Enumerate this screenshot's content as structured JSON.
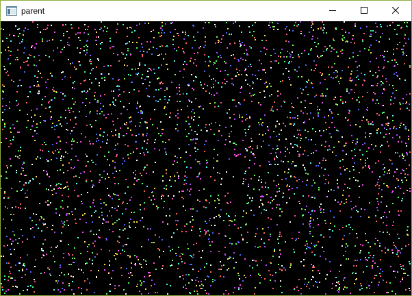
{
  "window": {
    "title": "parent",
    "icon": "app-window-icon",
    "controls": [
      {
        "name": "minimize-button",
        "icon": "minimize-icon"
      },
      {
        "name": "maximize-button",
        "icon": "maximize-icon"
      },
      {
        "name": "close-button",
        "icon": "close-icon"
      }
    ],
    "frame_color": "#8fae3f"
  },
  "canvas": {
    "background": "#000000",
    "palette": [
      "#ffffff",
      "#ff4df0",
      "#4dff6a",
      "#4d6aff",
      "#ffe14d",
      "#4dffe6",
      "#ff6a4d",
      "#a84dff",
      "#7bff4d",
      "#ff4d8e"
    ]
  }
}
